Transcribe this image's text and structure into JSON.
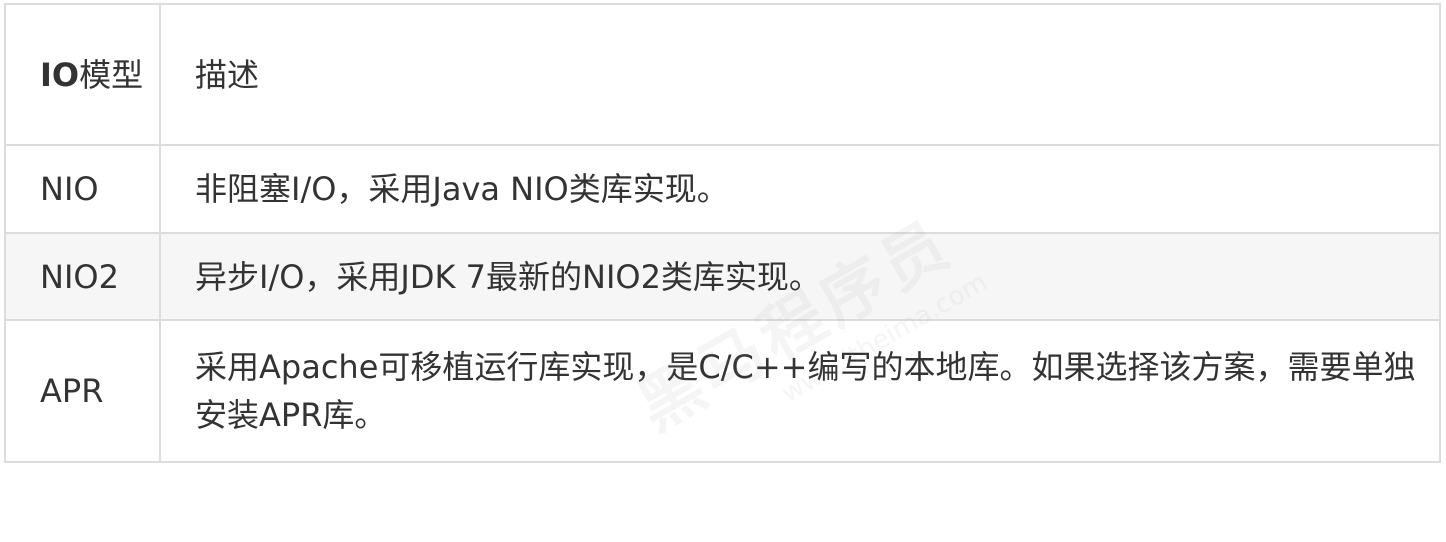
{
  "table": {
    "header": {
      "model_bold": "IO",
      "model_rest": "模型",
      "description": "描述"
    },
    "rows": [
      {
        "model": "NIO",
        "description": "非阻塞I/O，采用Java NIO类库实现。"
      },
      {
        "model": "NIO2",
        "description": "异步I/O，采用JDK 7最新的NIO2类库实现。"
      },
      {
        "model": "APR",
        "description": "采用Apache可移植运行库实现，是C/C++编写的本地库。如果选择该方案，需要单独安装APR库。"
      }
    ]
  },
  "watermark": {
    "brand": "黑马程序员",
    "url": "www.itheima.com"
  }
}
